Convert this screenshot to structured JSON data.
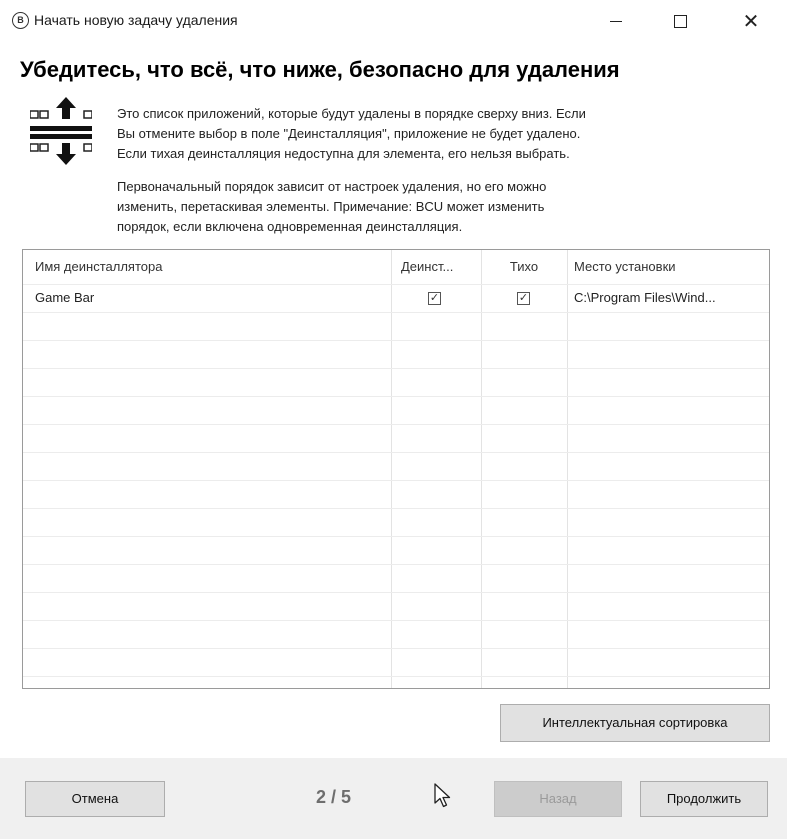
{
  "window": {
    "app_icon_letter": "B",
    "title": "Начать новую задачу удаления"
  },
  "heading": "Убедитесь, что всё, что ниже, безопасно для удаления",
  "description": {
    "paragraph1": [
      "Это список приложений, которые будут удалены в порядке сверху вниз. Если",
      "Вы отмените выбор в поле \"Деинсталляция\", приложение не будет удалено.",
      "Если тихая деинсталляция недоступна для элемента, его нельзя выбрать."
    ],
    "paragraph2": [
      "Первоначальный порядок зависит от настроек удаления, но его можно",
      "изменить, перетаскивая элементы. Примечание: BCU может изменить",
      "порядок, если включена одновременная деинсталляция."
    ]
  },
  "table": {
    "columns": [
      "Имя деинсталлятора",
      "Деинст...",
      "Тихо",
      "Место установки"
    ],
    "rows": [
      {
        "name": "Game Bar",
        "uninstall_checked": true,
        "quiet_checked": true,
        "location": "C:\\Program Files\\Wind..."
      }
    ]
  },
  "buttons": {
    "smart_sort": "Интеллектуальная сортировка",
    "cancel": "Отмена",
    "back": "Назад",
    "next": "Продолжить"
  },
  "page_indicator": "2 / 5",
  "checkmark_glyph": "✓",
  "icons": [
    "uninstaller-sort-icon",
    "minimize-icon",
    "maximize-icon",
    "close-icon",
    "mouse-cursor-icon"
  ]
}
